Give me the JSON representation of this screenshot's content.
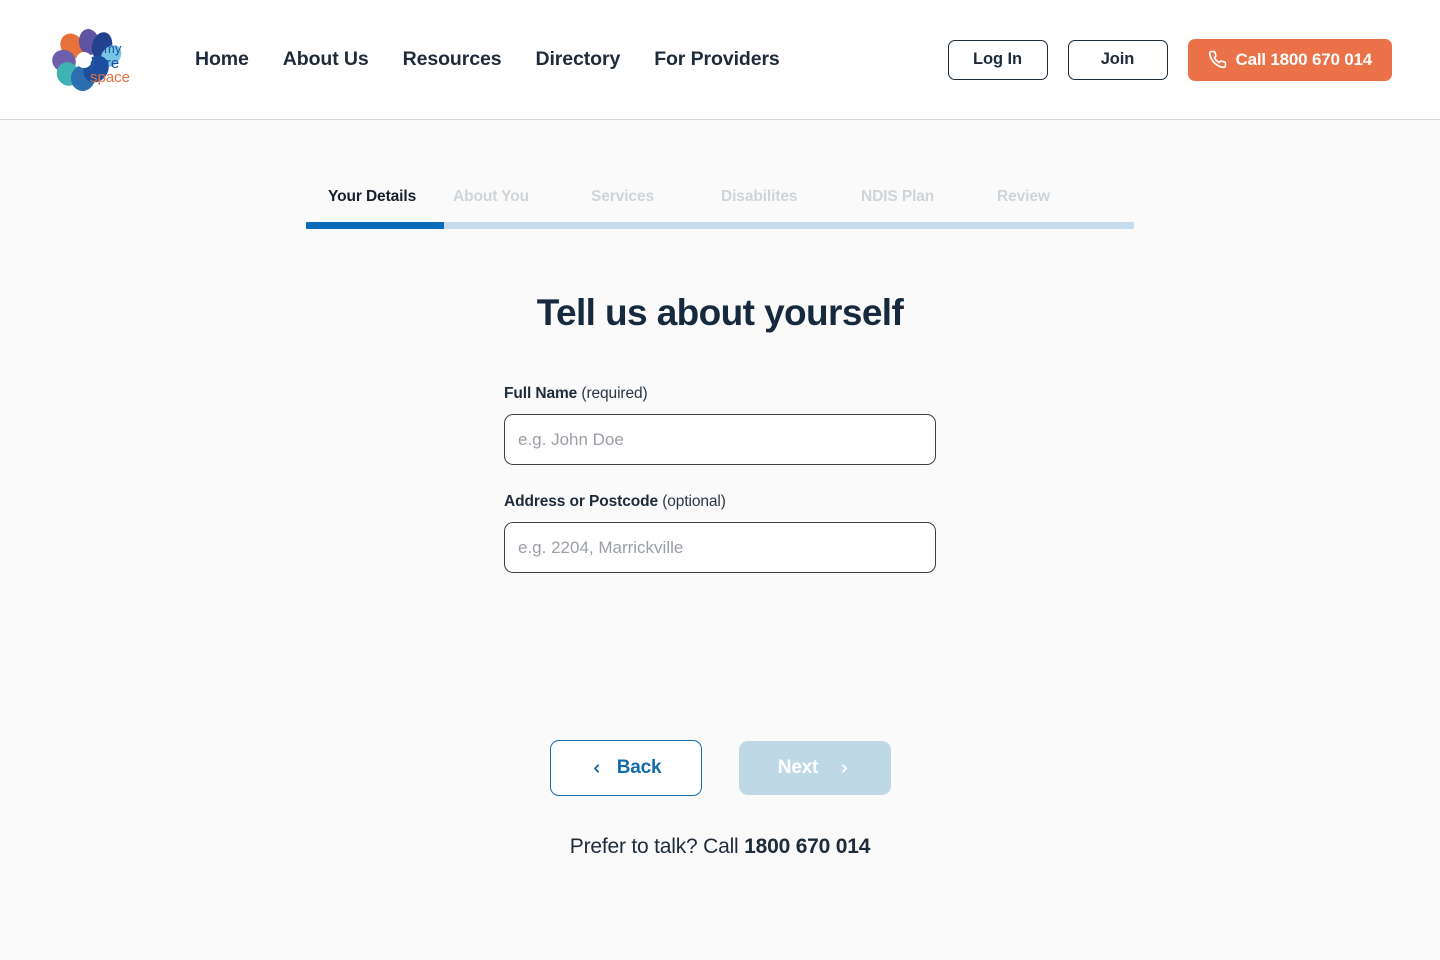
{
  "header": {
    "logo": {
      "name": "mycarespace-logo",
      "word_my": "my",
      "word_care": "care",
      "word_space": "space",
      "colors": {
        "orange": "#e8703a",
        "purple": "#6b5aa8",
        "navy": "#1b3f8f",
        "teal": "#3fb3b5",
        "lightblue": "#7fc3e8",
        "deepblue": "#1b4f9c"
      }
    },
    "nav": [
      {
        "label": "Home",
        "name": "nav-home"
      },
      {
        "label": "About Us",
        "name": "nav-about-us"
      },
      {
        "label": "Resources",
        "name": "nav-resources"
      },
      {
        "label": "Directory",
        "name": "nav-directory"
      },
      {
        "label": "For Providers",
        "name": "nav-for-providers"
      }
    ],
    "login_label": "Log In",
    "join_label": "Join",
    "call_label": "Call 1800 670 014",
    "call_icon": "phone-icon",
    "call_button_color": "#ea7148"
  },
  "stepper": {
    "steps": [
      {
        "label": "Your Details",
        "state": "active"
      },
      {
        "label": "About You",
        "state": "upcoming"
      },
      {
        "label": "Services",
        "state": "upcoming"
      },
      {
        "label": "Disabilites",
        "state": "upcoming"
      },
      {
        "label": "NDIS Plan",
        "state": "upcoming"
      },
      {
        "label": "Review",
        "state": "upcoming"
      }
    ],
    "progress_percent": 16.7,
    "active_color": "#0a6cb8",
    "track_color": "#c6dcec"
  },
  "main": {
    "title": "Tell us about yourself",
    "fields": [
      {
        "label_strong": "Full Name",
        "label_note": " (required)",
        "placeholder": "e.g. John Doe",
        "value": "",
        "required": true
      },
      {
        "label_strong": "Address or Postcode",
        "label_note": " (optional)",
        "placeholder": "e.g. 2204, Marrickville",
        "value": "",
        "required": false
      }
    ],
    "back_label": "Back",
    "back_icon": "chevron-left-icon",
    "next_label": "Next",
    "next_icon": "chevron-right-icon",
    "next_disabled": true,
    "prefer_talk_prefix": "Prefer to talk? Call ",
    "prefer_talk_phone": "1800 670 014"
  }
}
